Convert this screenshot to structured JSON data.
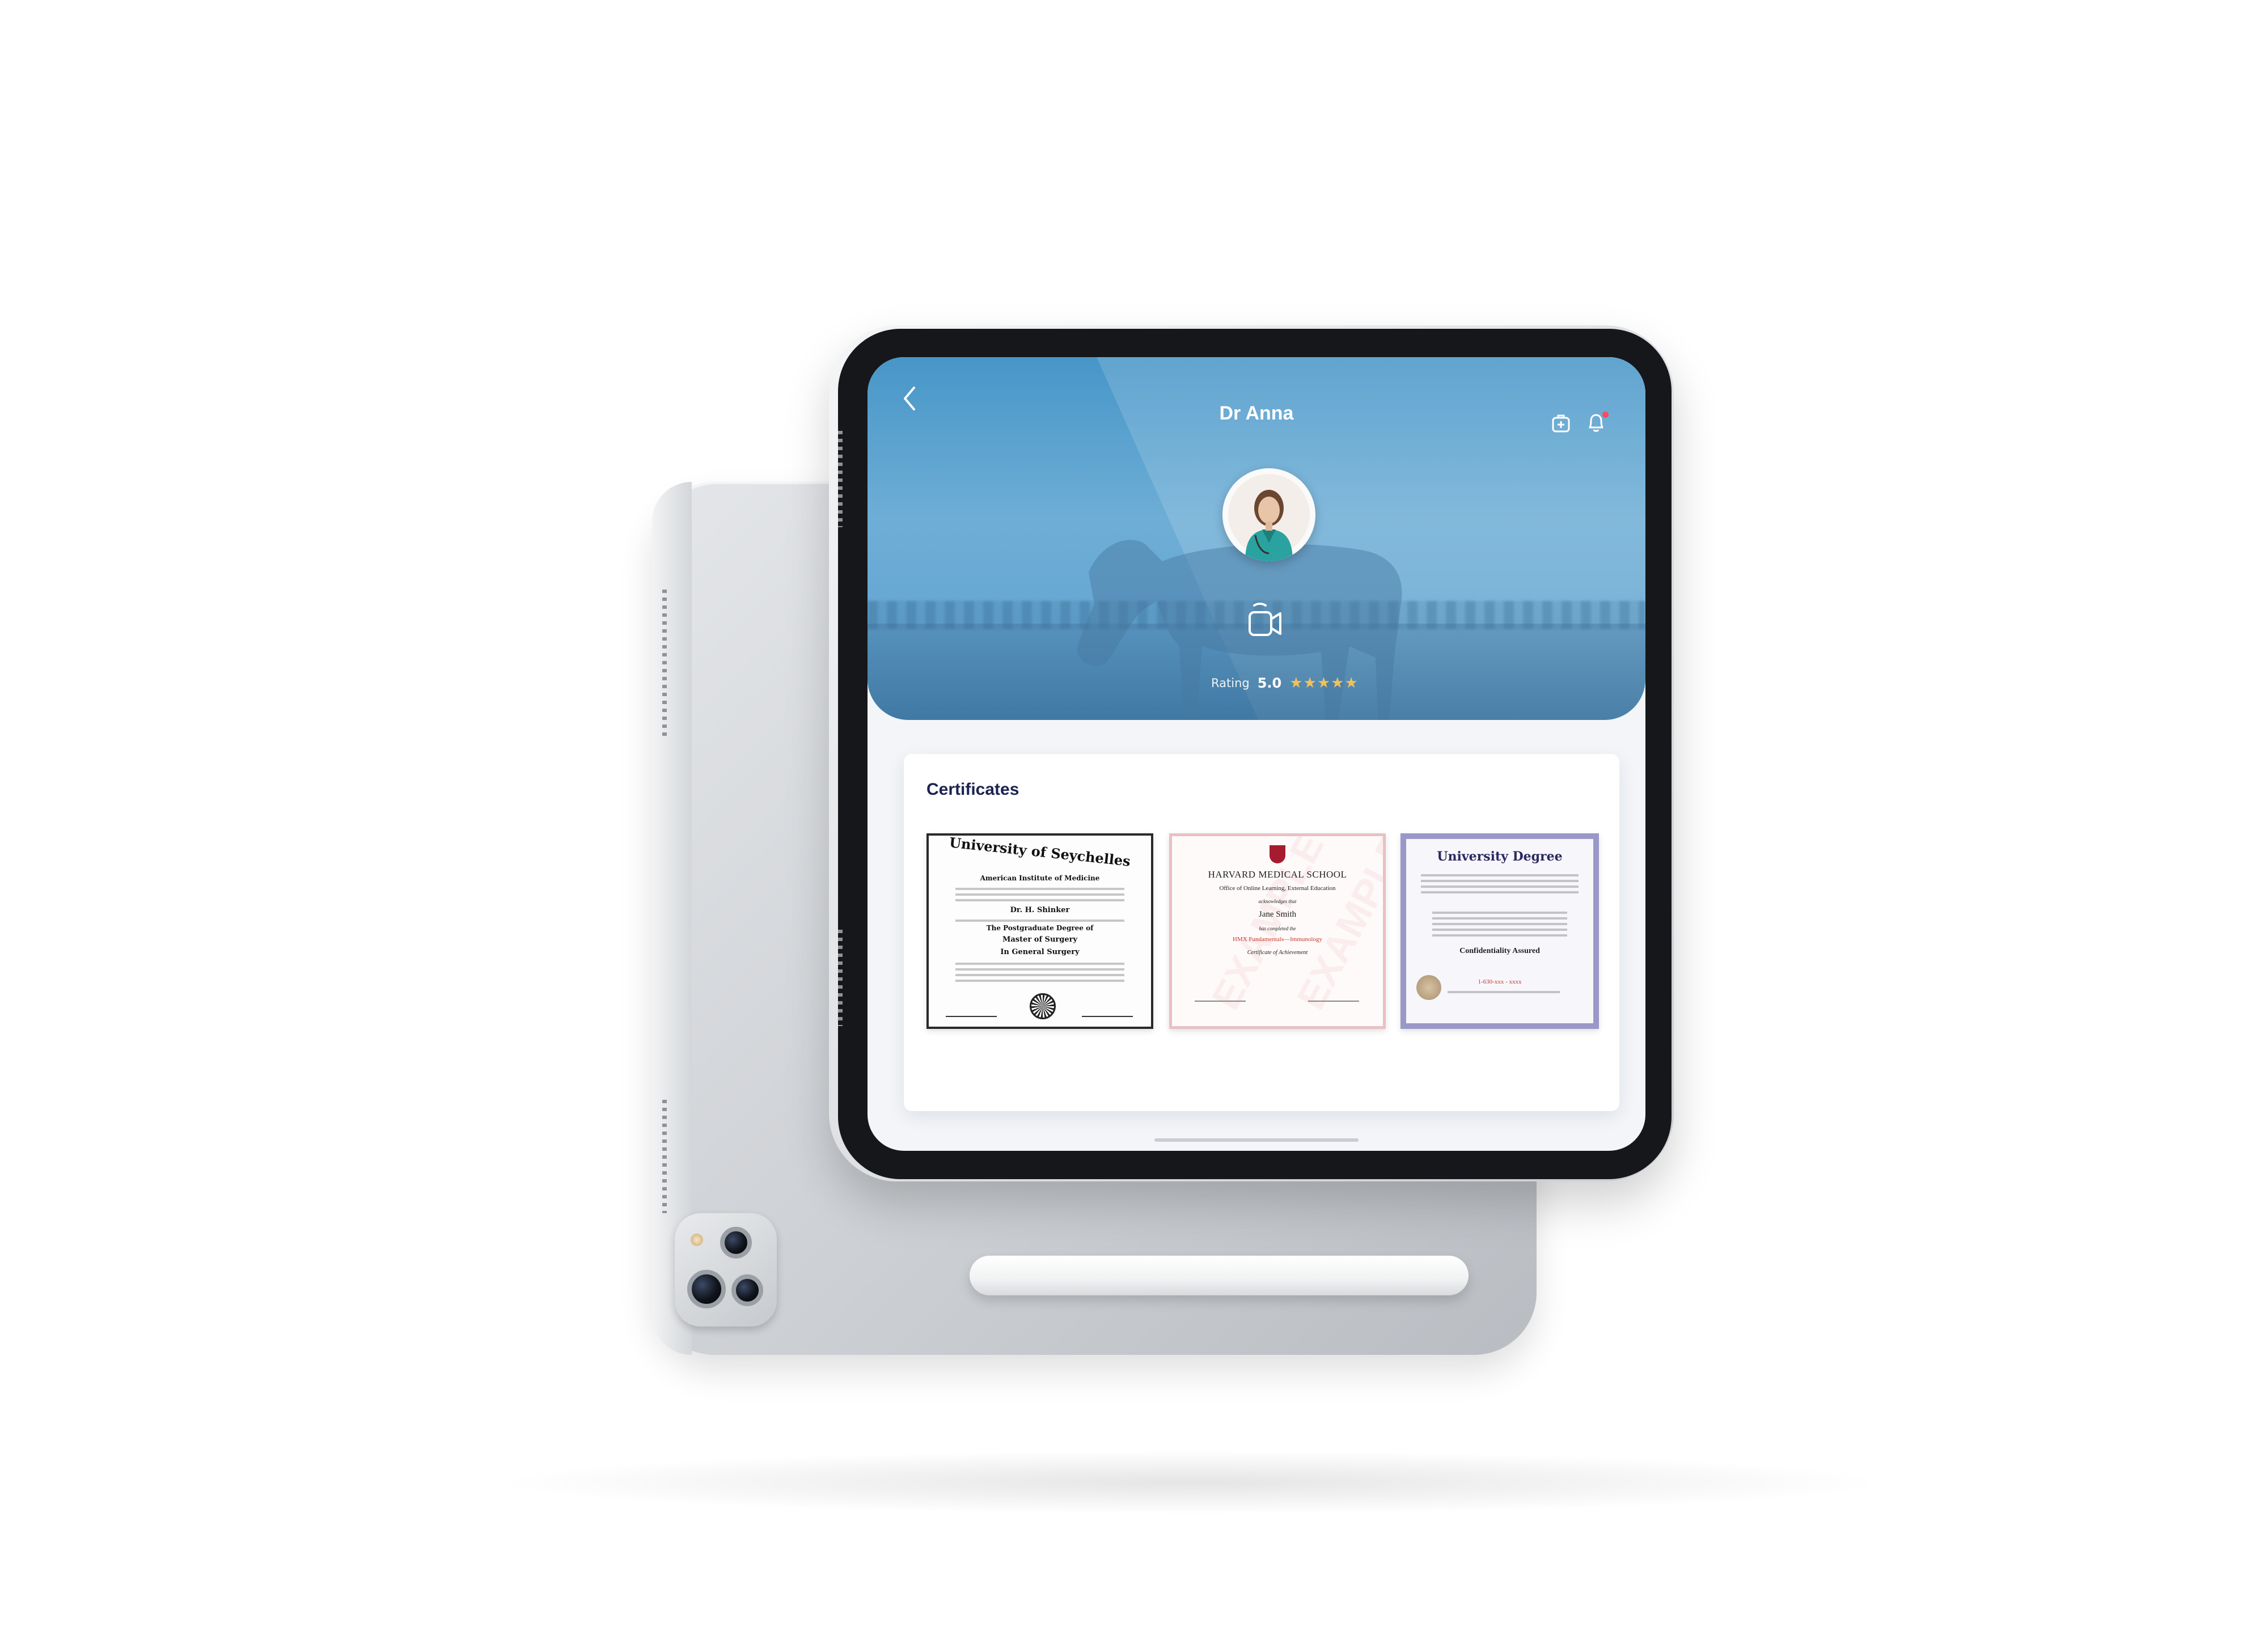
{
  "header": {
    "title": "Dr Anna",
    "back_icon": "chevron-left-icon",
    "icons": [
      "medical-bag-icon",
      "bell-icon"
    ],
    "notification_dot_color": "#ff4a5b",
    "background_color": "#5aa2d0"
  },
  "profile": {
    "rating_label": "Rating",
    "rating_value": "5.0",
    "stars": "★★★★★",
    "star_color": "#f0c15c",
    "video_icon": "video-camera-icon"
  },
  "certificates": {
    "title": "Certificates",
    "items": [
      {
        "heading": "University of Seychelles",
        "line1": "American Institute of Medicine",
        "recipient": "Dr. H. Shinker",
        "degree": "The Postgraduate Degree of",
        "degree2": "Master of Surgery",
        "degree3": "In General Surgery"
      },
      {
        "heading": "HARVARD MEDICAL SCHOOL",
        "line1": "Office of Online Learning, External Education",
        "line2": "acknowledges that",
        "recipient": "Jane Smith",
        "line3": "has completed the",
        "course": "HMX Fundamentals—Immunology",
        "footer": "Certificate of Achievement",
        "watermark": "EXAMPLE"
      },
      {
        "heading": "University Degree",
        "highlight": "Confidentiality Assured",
        "phone": "1-630-xxx - xxxx"
      }
    ]
  }
}
